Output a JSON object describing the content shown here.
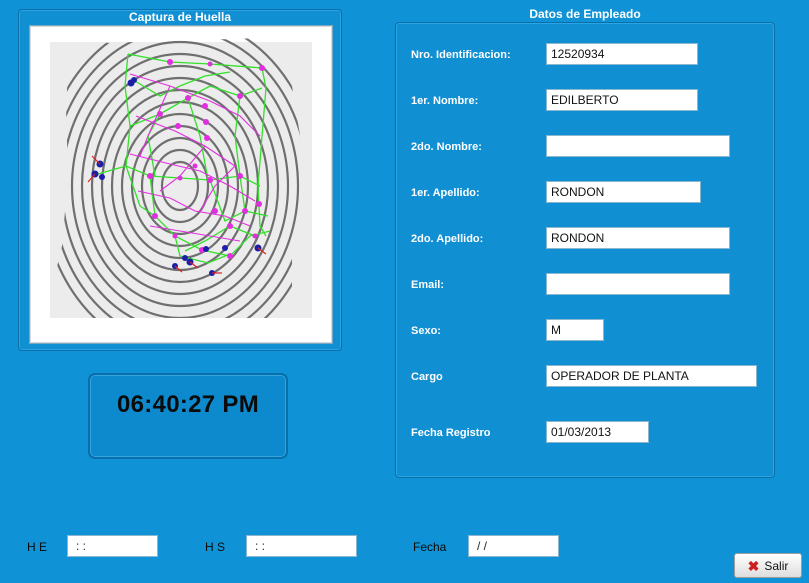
{
  "capture": {
    "title": "Captura de Huella"
  },
  "clock": {
    "time": "06:40:27 PM"
  },
  "employee": {
    "title": "Datos de Empleado",
    "fields": [
      {
        "label": "Nro. Identificacion:",
        "value": "12520934"
      },
      {
        "label": "1er. Nombre:",
        "value": "EDILBERTO"
      },
      {
        "label": "2do. Nombre:",
        "value": ""
      },
      {
        "label": "1er. Apellido:",
        "value": "RONDON"
      },
      {
        "label": "2do. Apellido:",
        "value": "RONDON"
      },
      {
        "label": "Email:",
        "value": ""
      },
      {
        "label": "Sexo:",
        "value": "M"
      },
      {
        "label": "Cargo",
        "value": "OPERADOR DE PLANTA"
      },
      {
        "label": "Fecha Registro",
        "value": "01/03/2013"
      }
    ]
  },
  "bottom": {
    "he_label": "H E",
    "he_value": " : :",
    "hs_label": "H S",
    "hs_value": " : :",
    "fecha_label": "Fecha",
    "fecha_value": " / /"
  },
  "exit_button": {
    "label": "Salir",
    "icon": "close-icon"
  },
  "colors": {
    "background": "#0f93d6",
    "minutiae_lines": "#33e02a",
    "minutiae_points": "#e22ee0",
    "core_points": "#1b1fa6"
  }
}
